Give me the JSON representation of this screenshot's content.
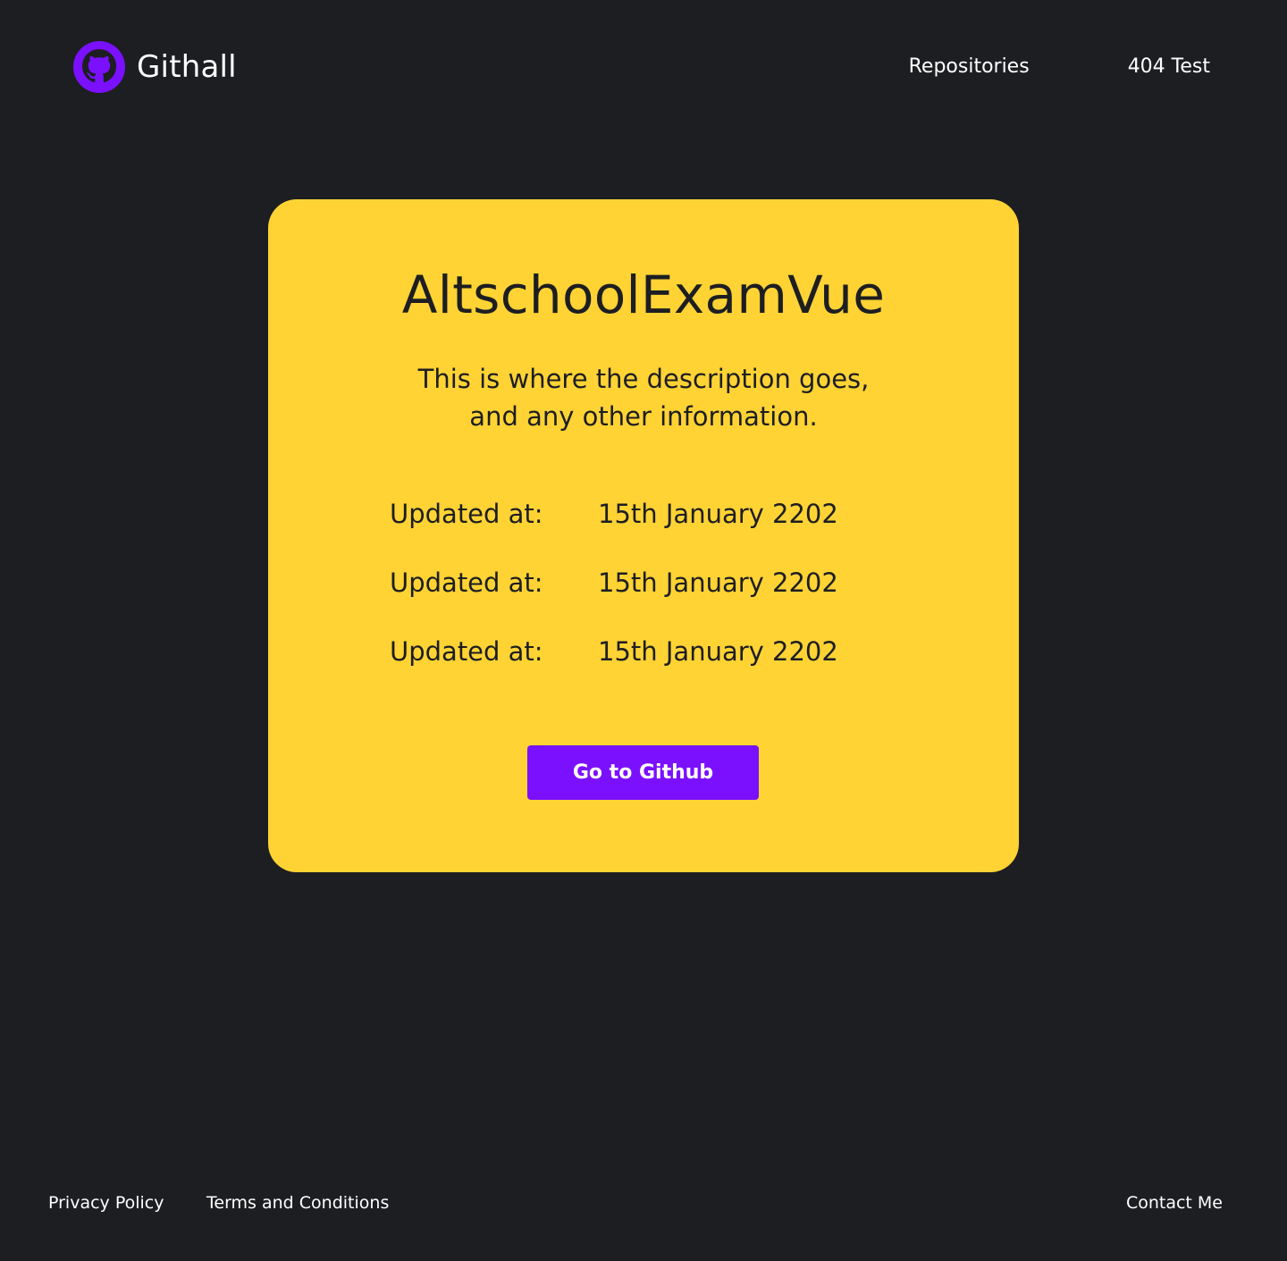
{
  "header": {
    "brand_name": "Githall",
    "nav": [
      {
        "label": "Repositories"
      },
      {
        "label": "404 Test"
      }
    ]
  },
  "repo": {
    "title": "AltschoolExamVue",
    "description_line1": "This is where the description goes,",
    "description_line2": "and any other information.",
    "meta": [
      {
        "label": "Updated at:",
        "value": "15th January 2202"
      },
      {
        "label": "Updated at:",
        "value": "15th January 2202"
      },
      {
        "label": "Updated at:",
        "value": "15th January 2202"
      }
    ],
    "button_label": "Go to Github"
  },
  "footer": {
    "privacy": "Privacy Policy",
    "terms": "Terms and Conditions",
    "contact": "Contact Me"
  },
  "colors": {
    "background": "#1d1e22",
    "card": "#ffd334",
    "accent": "#7b10ff",
    "text_light": "#ffffff",
    "text_dark": "#1d1e22"
  },
  "icons": {
    "brand_logo": "github-icon"
  }
}
